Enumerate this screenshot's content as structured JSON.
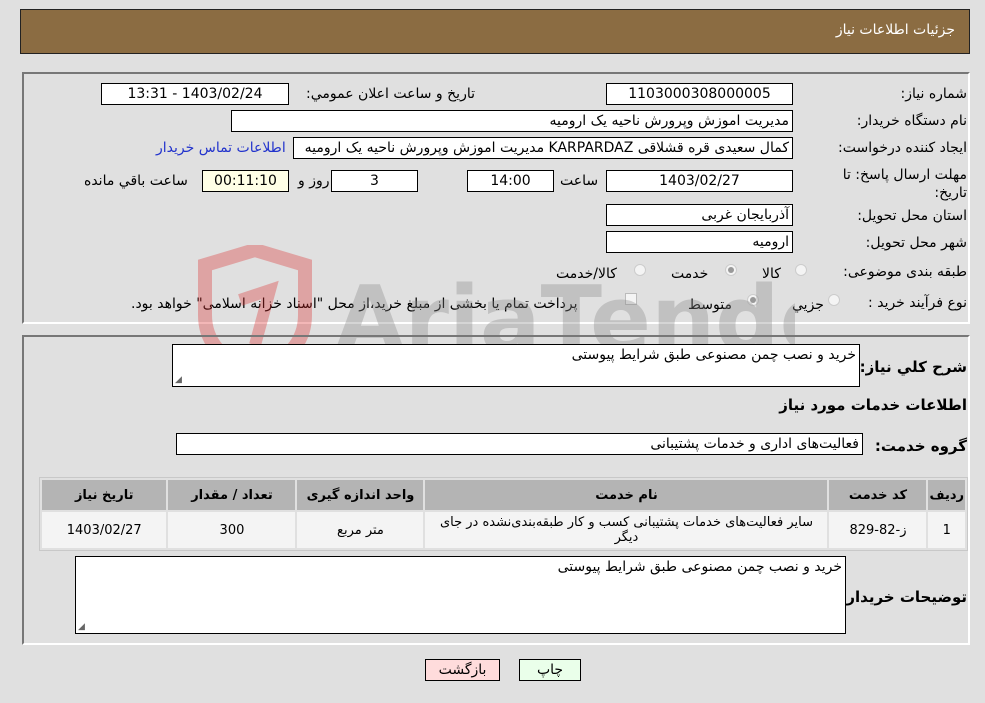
{
  "header": {
    "title": "جزئیات اطلاعات نیاز"
  },
  "form": {
    "need_number_label": "شماره نیاز:",
    "need_number": "1103000308000005",
    "announce_label": "تاریخ و ساعت اعلان عمومي:",
    "announce_value": "1403/02/24 - 13:31",
    "buyer_org_label": "نام دستگاه خریدار:",
    "buyer_org": "مدیریت اموزش وپرورش ناحیه یک ارومیه",
    "creator_label": "ایجاد کننده درخواست:",
    "creator": "کمال سعیدی قره قشلاقی KARPARDAZ مدیریت اموزش وپرورش ناحیه یک ارومیه",
    "contact_link": "اطلاعات تماس خریدار",
    "deadline_label": "مهلت ارسال پاسخ: تا تاریخ:",
    "deadline_date": "1403/02/27",
    "time_label": "ساعت",
    "deadline_time": "14:00",
    "days_value": "3",
    "days_label": "روز و",
    "remaining_time": "00:11:10",
    "remaining_label": "ساعت باقي مانده",
    "province_label": "استان محل تحویل:",
    "province": "آذربایجان غربی",
    "city_label": "شهر محل تحویل:",
    "city": "ارومیه",
    "category_label": "طبقه بندی موضوعی:",
    "category_options": [
      "کالا",
      "خدمت",
      "کالا/خدمت"
    ],
    "category_selected": "خدمت",
    "process_label": "نوع فرآیند خرید :",
    "process_options": [
      "جزیي",
      "متوسط"
    ],
    "process_selected": "متوسط",
    "treasury_note": "پرداخت تمام یا بخشی از مبلغ خرید،از محل \"اسناد خزانه اسلامی\" خواهد بود."
  },
  "details": {
    "description_label": "شرح کلي نیاز:",
    "description": "خرید و نصب چمن مصنوعی طبق شرایط پیوستی",
    "services_heading": "اطلاعات خدمات مورد نیاز",
    "service_group_label": "گروه خدمت:",
    "service_group": "فعالیت‌های اداری و خدمات پشتیبانی",
    "table": {
      "headers": [
        "ردیف",
        "کد خدمت",
        "نام خدمت",
        "واحد اندازه گیری",
        "تعداد / مقدار",
        "تاریخ نیاز"
      ],
      "rows": [
        [
          "1",
          "ز-82-829",
          "سایر فعالیت‌های خدمات پشتیبانی کسب و کار طبقه‌بندی‌نشده در جای دیگر",
          "متر مربع",
          "300",
          "1403/02/27"
        ]
      ]
    },
    "buyer_notes_label": "توضیحات خریدار:",
    "buyer_notes": "خرید و نصب چمن مصنوعی طبق شرایط پیوستی"
  },
  "buttons": {
    "print": "چاپ",
    "back": "بازگشت"
  },
  "watermark": {
    "text": "AriaTender.neT"
  }
}
